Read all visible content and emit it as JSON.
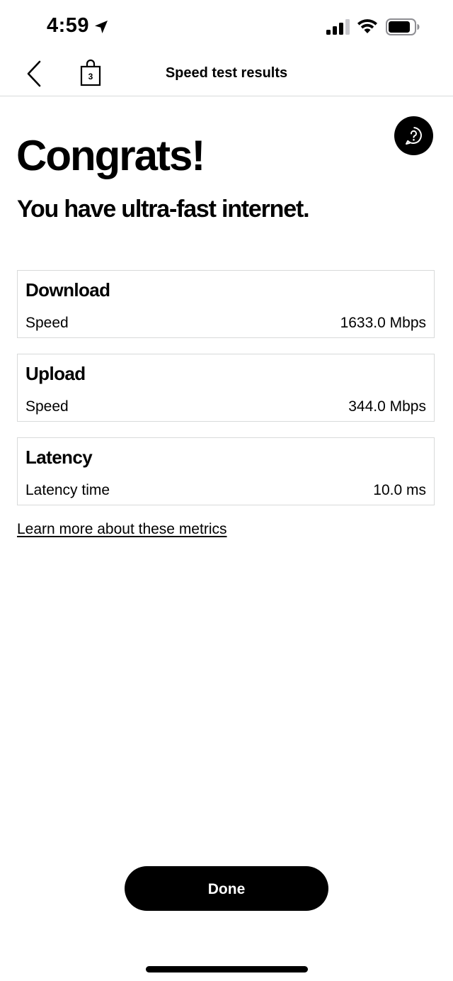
{
  "status_bar": {
    "time": "4:59",
    "icons": [
      "location-arrow-icon",
      "cellular-signal-icon",
      "wifi-icon",
      "battery-icon"
    ]
  },
  "nav": {
    "back_icon": "chevron-left-icon",
    "bag_icon": "shopping-bag-icon",
    "bag_count": "3",
    "title": "Speed test results"
  },
  "help": {
    "icon": "help-chat-icon"
  },
  "headline": "Congrats!",
  "subheadline": "You have ultra-fast internet.",
  "metrics": [
    {
      "title": "Download",
      "label": "Speed",
      "value": "1633.0 Mbps"
    },
    {
      "title": "Upload",
      "label": "Speed",
      "value": "344.0 Mbps"
    },
    {
      "title": "Latency",
      "label": "Latency time",
      "value": "10.0 ms"
    }
  ],
  "learn_more_link": "Learn more about these metrics",
  "done_button": "Done",
  "colors": {
    "text": "#000000",
    "background": "#ffffff",
    "border": "#d8dada",
    "button_bg": "#000000",
    "button_text": "#ffffff"
  }
}
